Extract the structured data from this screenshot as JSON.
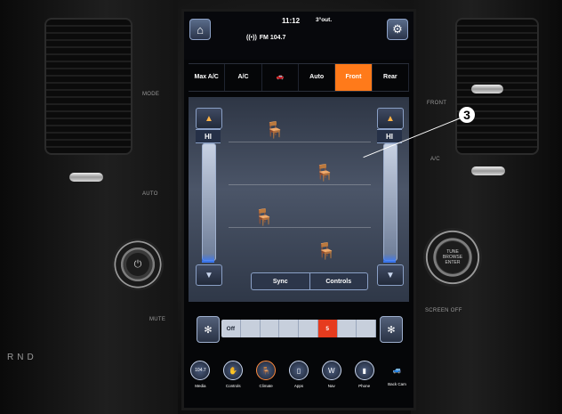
{
  "status_bar": {
    "time": "11:12",
    "temperature": "3°out.",
    "radio": "FM 104.7"
  },
  "tabs": [
    {
      "label": "Max A/C"
    },
    {
      "label": "A/C"
    },
    {
      "label": ""
    },
    {
      "label": "Auto"
    },
    {
      "label": "Front",
      "active": true
    },
    {
      "label": "Rear"
    }
  ],
  "climate": {
    "left_temp": "HI",
    "right_temp": "HI",
    "sync_label": "Sync",
    "controls_label": "Controls"
  },
  "fan": {
    "off_label": "Off",
    "level": "5"
  },
  "dock": [
    {
      "label": "Media",
      "icon": "104.7"
    },
    {
      "label": "Controls",
      "icon": "controls-icon"
    },
    {
      "label": "Climate",
      "icon": "climate-icon"
    },
    {
      "label": "Apps",
      "icon": "apps-icon"
    },
    {
      "label": "Nav",
      "icon": "nav-icon"
    },
    {
      "label": "Phone",
      "icon": "phone-icon"
    },
    {
      "label": "Back Cam",
      "icon": "back-cam-icon"
    }
  ],
  "side_buttons_left": [
    "MODE",
    "AUTO"
  ],
  "side_buttons_right": [
    "FRONT",
    "A/C"
  ],
  "knob_left_label": "",
  "knob_right_label": "TUNE BROWSE ENTER",
  "mute_label": "MUTE",
  "screen_off_label": "SCREEN OFF",
  "gear_text": "RND",
  "callout_number": "3",
  "colors": {
    "accent": "#ff7a1a",
    "fan_active": "#e63b1e"
  }
}
